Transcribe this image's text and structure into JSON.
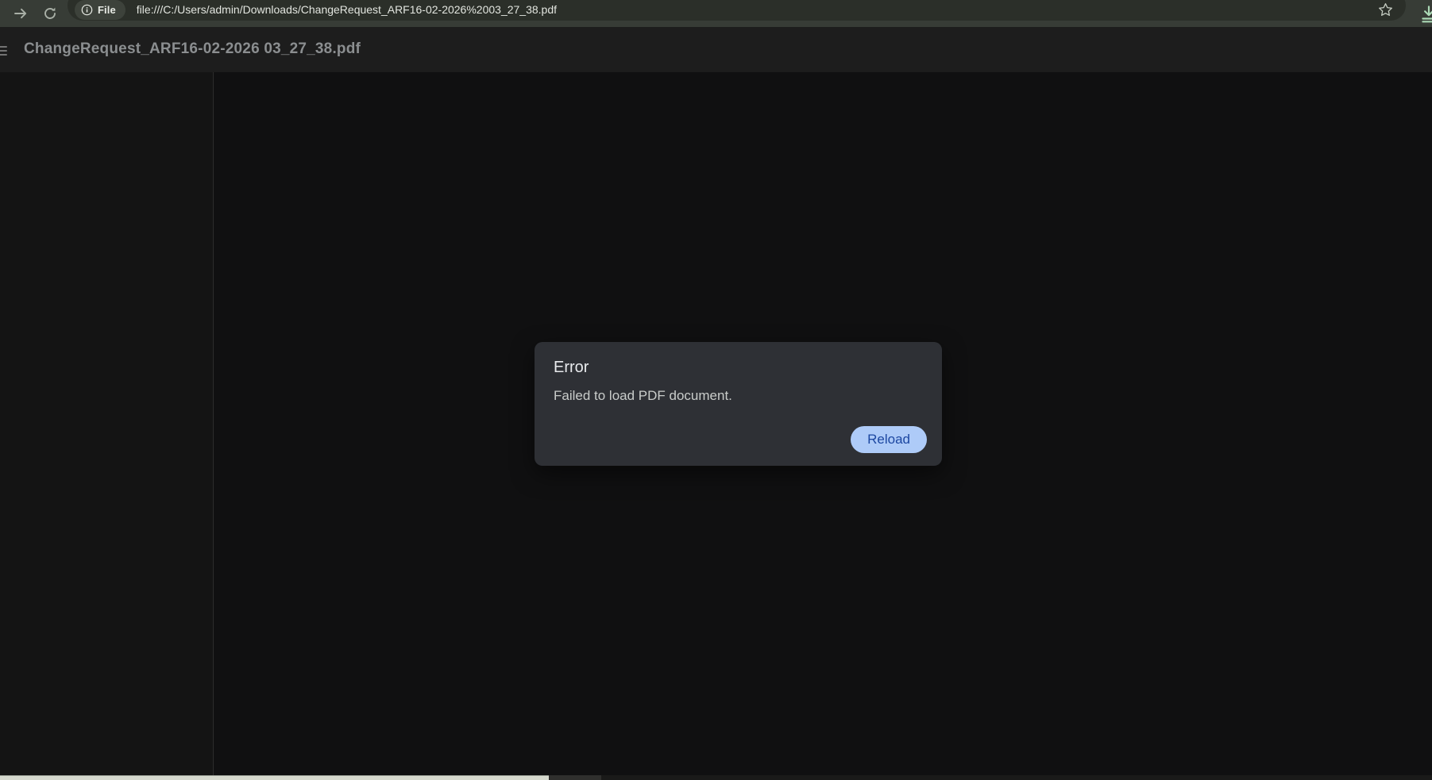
{
  "browser": {
    "url": "file:///C:/Users/admin/Downloads/ChangeRequest_ARF16-02-2026%2003_27_38.pdf",
    "site_chip_label": "File"
  },
  "pdf_viewer": {
    "title": "ChangeRequest_ARF16-02-2026 03_27_38.pdf"
  },
  "error_dialog": {
    "title": "Error",
    "message": "Failed to load PDF document.",
    "reload_label": "Reload"
  },
  "colors": {
    "browser_bar": "#373c36",
    "omnibox": "#2b2f29",
    "chip": "#3d423b",
    "pdf_toolbar": "#1d1d1d",
    "content": "#121212",
    "dialog": "#2e3035",
    "accent_button_bg": "#aecbf8",
    "accent_button_text": "#1c47a1",
    "download_icon_green": "#abd9b5",
    "bottom_bar": "#d6d9ce"
  }
}
